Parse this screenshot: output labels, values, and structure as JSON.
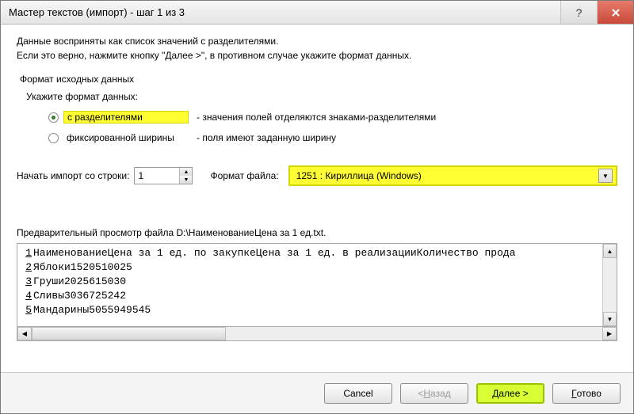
{
  "window": {
    "title": "Мастер текстов (импорт) - шаг 1 из 3"
  },
  "intro": {
    "line1": "Данные восприняты как список значений с разделителями.",
    "line2": "Если это верно, нажмите кнопку \"Далее >\", в противном случае укажите формат данных."
  },
  "format_group": {
    "label": "Формат исходных данных",
    "sub_label": "Укажите формат данных:",
    "options": [
      {
        "name": "с разделителями",
        "desc": "- значения полей отделяются знаками-разделителями",
        "checked": true,
        "highlight": true
      },
      {
        "name": "фиксированной ширины",
        "desc": "- поля имеют заданную ширину",
        "checked": false,
        "highlight": false
      }
    ]
  },
  "start_row": {
    "label": "Начать импорт со строки:",
    "value": "1"
  },
  "file_origin": {
    "label": "Формат файла:",
    "value": "1251 : Кириллица (Windows)"
  },
  "preview": {
    "label": "Предварительный просмотр файла D:\\НаименованиеЦена за 1 ед.txt.",
    "lines": [
      "НаименованиеЦена за 1 ед. по закупкеЦена за 1 ед. в реализацииКоличество прода",
      "Яблоки1520510025",
      "Груши2025615030",
      "Сливы3036725242",
      "Мандарины5055949545"
    ]
  },
  "buttons": {
    "cancel": "Cancel",
    "back": "< Назад",
    "next": "Далее >",
    "finish": "Готово",
    "next_mnemonic": "Д",
    "next_rest": "алее >",
    "finish_mnemonic": "Г",
    "finish_rest": "отово",
    "back_prefix": "< ",
    "back_mnemonic": "Н",
    "back_rest": "азад"
  }
}
